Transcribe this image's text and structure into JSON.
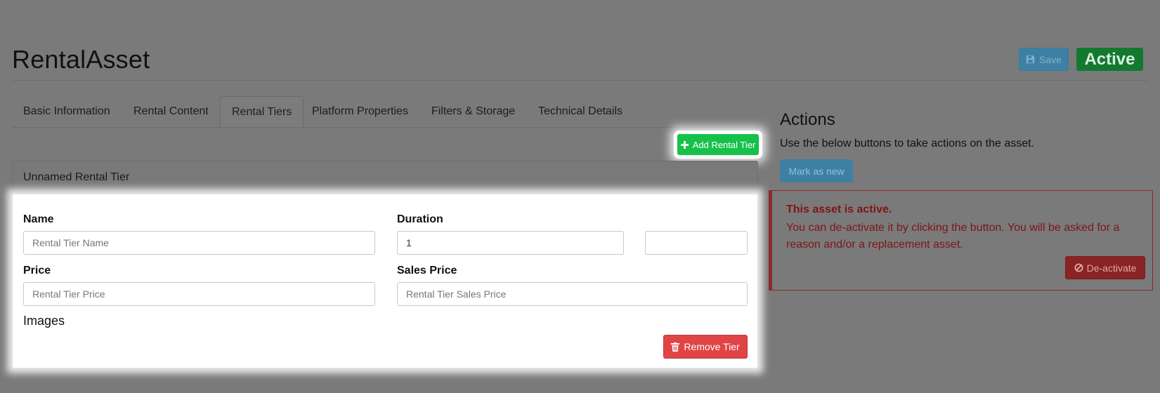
{
  "page": {
    "title": "RentalAsset"
  },
  "header": {
    "save_label": "Save",
    "status_badge": "Active"
  },
  "tabs": [
    {
      "label": "Basic Information"
    },
    {
      "label": "Rental Content"
    },
    {
      "label": "Rental Tiers",
      "selected": true
    },
    {
      "label": "Platform Properties"
    },
    {
      "label": "Filters & Storage"
    },
    {
      "label": "Technical Details"
    }
  ],
  "rental_tiers": {
    "add_label": "Add Rental Tier",
    "tier": {
      "header": "Unnamed Rental Tier",
      "name_label": "Name",
      "name_placeholder": "Rental Tier Name",
      "duration_label": "Duration",
      "duration_value": "1",
      "duration_unit_value": "",
      "price_label": "Price",
      "price_placeholder": "Rental Tier Price",
      "sales_price_label": "Sales Price",
      "sales_price_placeholder": "Rental Tier Sales Price",
      "images_label": "Images",
      "remove_label": "Remove Tier"
    }
  },
  "actions": {
    "title": "Actions",
    "description": "Use the below buttons to take actions on the asset.",
    "mark_new_label": "Mark as new",
    "alert": {
      "title": "This asset is active.",
      "text": "You can de-activate it by clicking the button. You will be asked for a reason and/or a replacement asset.",
      "deactivate_label": "De-activate"
    }
  },
  "colors": {
    "add_button": "#16c14a",
    "remove_button": "#e04545",
    "active_badge": "#12792f",
    "save_button": "#3d80a3",
    "alert_text": "#7e1616"
  },
  "icons": {
    "save": "floppy-disk-icon",
    "add": "plus-icon",
    "remove": "trash-icon",
    "deactivate": "ban-icon"
  }
}
